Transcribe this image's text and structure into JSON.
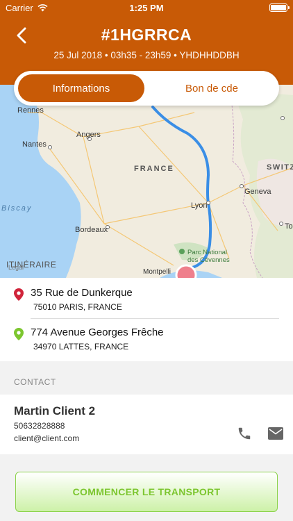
{
  "status_bar": {
    "carrier": "Carrier",
    "time": "1:25 PM"
  },
  "header": {
    "title": "#1HGRRCA",
    "subtitle": "25 Jul 2018 • 03h35 - 23h59 • YHDHHDDBH"
  },
  "tabs": [
    {
      "label": "Informations",
      "active": true
    },
    {
      "label": "Bon de cde",
      "active": false
    }
  ],
  "map": {
    "labels": {
      "rennes": "Rennes",
      "angers": "Angers",
      "nantes": "Nantes",
      "france": "FRANCE",
      "switz": "SWITZ",
      "geneva": "Geneva",
      "lyon": "Lyon",
      "biscay": "Biscay",
      "bordeaux": "Bordeaux",
      "tours": "To",
      "park_line1": "Parc National",
      "park_line2": "des Cévennes",
      "itineraire": "ITINÉRAIRE",
      "legal": "Legal",
      "montpellier": "Montpelli"
    }
  },
  "addresses": [
    {
      "street": "35 Rue de Dunkerque",
      "city": "75010 PARIS, FRANCE"
    },
    {
      "street": "774 Avenue Georges Frêche",
      "city": "34970 LATTES, FRANCE"
    }
  ],
  "contact": {
    "section_label": "CONTACT",
    "name": "Martin Client 2",
    "phone": "50632828888",
    "email": "client@client.com"
  },
  "cta": {
    "label": "COMMENCER LE TRANSPORT"
  },
  "colors": {
    "primary": "#c85a06",
    "route": "#3a8ee6",
    "pin_start": "#d0243a",
    "pin_end": "#7cc62f",
    "cta_text": "#7cc62f"
  }
}
